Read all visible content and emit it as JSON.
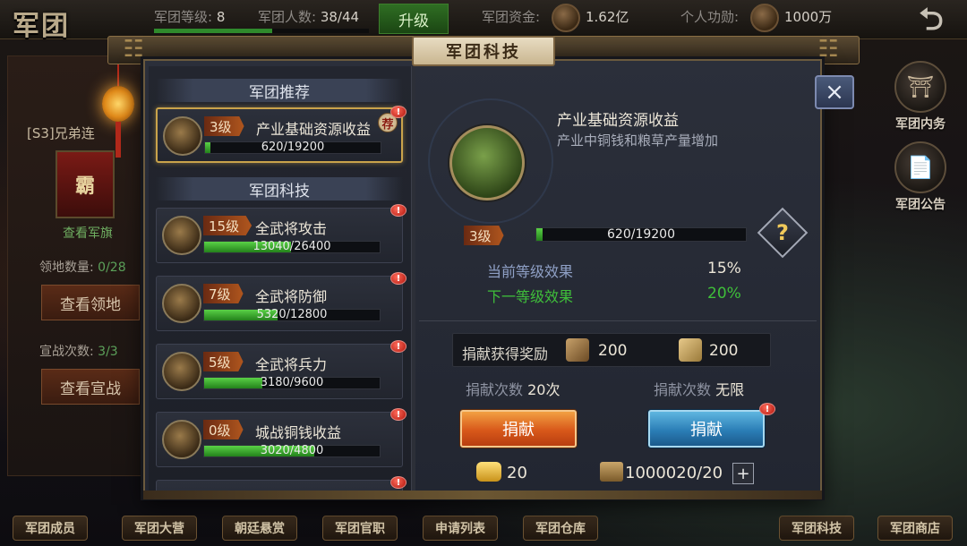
{
  "topbar": {
    "logo": "军团",
    "level_label": "军团等级:",
    "level_value": "8",
    "members_label": "军团人数:",
    "members_value": "38/44",
    "upgrade_label": "升级",
    "funds_label": "军团资金:",
    "funds_value": "1.62亿",
    "merit_label": "个人功勋:",
    "merit_value": "1000万",
    "level_progress": 0.55
  },
  "left_panel": {
    "guild_name": "[S3]兄弟连",
    "flag_char": "霸",
    "flag_link": "查看军旗",
    "territory_label": "领地数量:",
    "territory_value": "0/28",
    "territory_button": "查看领地",
    "war_label": "宣战次数:",
    "war_value": "3/3",
    "war_button": "查看宣战"
  },
  "right_panel": {
    "items": [
      {
        "label": "军团内务",
        "icon": "gate-icon"
      },
      {
        "label": "军团公告",
        "icon": "notice-icon"
      }
    ]
  },
  "bottom_nav": [
    "军团成员",
    "军团大营",
    "朝廷悬赏",
    "军团官职",
    "申请列表",
    "军团仓库",
    "军团科技",
    "军团商店"
  ],
  "modal": {
    "title": "军团科技",
    "recommend_header": "军团推荐",
    "tech_header": "军团科技",
    "recommended": {
      "level": "3级",
      "name": "产业基础资源收益",
      "progress_text": "620/19200",
      "progress": 0.032,
      "badge": "荐"
    },
    "techs": [
      {
        "level": "15级",
        "name": "全武将攻击",
        "progress_text": "13040/26400",
        "progress": 0.494
      },
      {
        "level": "7级",
        "name": "全武将防御",
        "progress_text": "5320/12800",
        "progress": 0.416
      },
      {
        "level": "5级",
        "name": "全武将兵力",
        "progress_text": "3180/9600",
        "progress": 0.331
      },
      {
        "level": "0级",
        "name": "城战铜钱收益",
        "progress_text": "3020/4800",
        "progress": 0.629
      }
    ],
    "detail": {
      "title": "产业基础资源收益",
      "desc": "产业中铜钱和粮草产量增加",
      "level": "3级",
      "progress_text": "620/19200",
      "progress": 0.032,
      "current_effect_label": "当前等级效果",
      "current_effect_value": "15%",
      "next_effect_label": "下一等级效果",
      "next_effect_value": "20%",
      "reward_label": "捐献获得奖励",
      "reward_1": "200",
      "reward_2": "200",
      "donate_left_label": "捐献次数",
      "donate_left_value": "20次",
      "donate_right_label": "捐献次数",
      "donate_right_value": "无限",
      "donate_button_left": "捐献",
      "donate_button_right": "捐献",
      "gold_value": "20",
      "token_value": "1000020/20",
      "plus": "+"
    },
    "close": "×"
  },
  "colors": {
    "green_progress": "#3fae2f",
    "orange_button": "#d8581a",
    "blue_button": "#2b7eb6",
    "next_effect": "#3fbf3a"
  }
}
